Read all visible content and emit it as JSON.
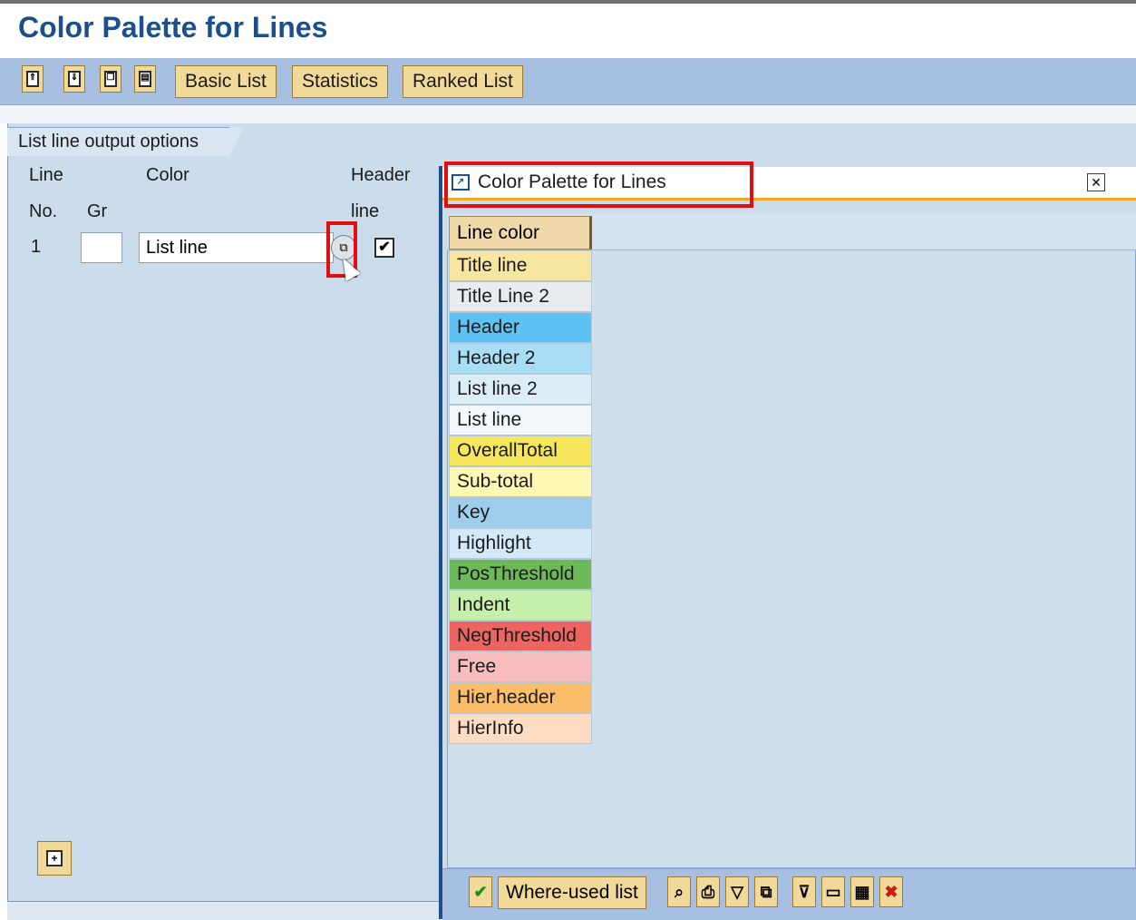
{
  "page": {
    "title": "Color Palette for Lines"
  },
  "toolbar": {
    "icons": [
      "expand-all-icon",
      "collapse-all-icon",
      "copy-icon",
      "layout-icon"
    ],
    "buttons": [
      "Basic List",
      "Statistics",
      "Ranked List"
    ]
  },
  "group": {
    "tab_label": "List line output options"
  },
  "columns": {
    "line_top": "Line",
    "line_bottom": "No.",
    "gr": "Gr",
    "color": "Color",
    "header_top": "Header",
    "header_bottom": "line"
  },
  "row": {
    "line_no": "1",
    "gr_value": "",
    "color_value": "List line",
    "header_line_checked": true,
    "checkmark": "✔"
  },
  "dialog": {
    "title": "Color Palette for Lines",
    "close_symbol": "✕",
    "column_header": "Line color",
    "rows": [
      {
        "label": "Title line",
        "color": "#f6e6a0"
      },
      {
        "label": "Title Line 2",
        "color": "#e8ebf0"
      },
      {
        "label": "Header",
        "color": "#5ec1f3"
      },
      {
        "label": "Header 2",
        "color": "#a7def5"
      },
      {
        "label": "List line 2",
        "color": "#dcedf6"
      },
      {
        "label": "List line",
        "color": "#f2f8fc"
      },
      {
        "label": "OverallTotal",
        "color": "#f6e65c"
      },
      {
        "label": "Sub-total",
        "color": "#fdf7b3"
      },
      {
        "label": "Key",
        "color": "#9fcdec"
      },
      {
        "label": "Highlight",
        "color": "#d3e9f9"
      },
      {
        "label": "PosThreshold",
        "color": "#6cba57"
      },
      {
        "label": "Indent",
        "color": "#c6efa9"
      },
      {
        "label": "NegThreshold",
        "color": "#ee6460"
      },
      {
        "label": "Free",
        "color": "#f7bdbe"
      },
      {
        "label": "Hier.header",
        "color": "#fbbd68"
      },
      {
        "label": "HierInfo",
        "color": "#fcdcc3"
      }
    ],
    "footer": {
      "where_used_label": "Where-used list",
      "icons": [
        "confirm-icon",
        "find-icon",
        "print-icon",
        "sort-icon",
        "binoculars-icon",
        "filter-icon",
        "print-preview-icon",
        "grid-icon",
        "cancel-icon"
      ]
    }
  },
  "colors": {
    "title": "#1d4f8a",
    "toolbar": "#a7c0e2",
    "panel": "#cbdcec",
    "highlight_box": "#e01010",
    "accent_line": "#f6a623"
  }
}
